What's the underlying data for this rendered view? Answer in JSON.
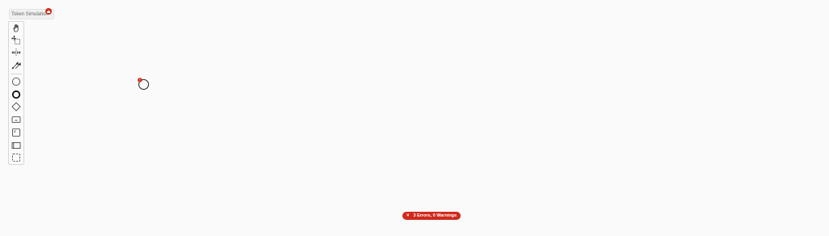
{
  "token_simulation": {
    "label": "Token Simulation"
  },
  "palette": {
    "tools": [
      {
        "icon": "hand-tool-icon"
      },
      {
        "icon": "lasso-tool-icon"
      },
      {
        "icon": "space-tool-icon"
      },
      {
        "icon": "global-connect-tool-icon"
      }
    ],
    "elements": [
      {
        "icon": "start-event-icon"
      },
      {
        "icon": "end-event-icon"
      },
      {
        "icon": "gateway-icon"
      },
      {
        "icon": "task-icon"
      },
      {
        "icon": "data-object-icon"
      },
      {
        "icon": "pool-icon"
      },
      {
        "icon": "group-icon"
      }
    ]
  },
  "lint": {
    "status_text": "3 Errors, 0 Warnings",
    "close_glyph": "×"
  },
  "colors": {
    "error": "#cf2a1c",
    "canvas": "#fafafa",
    "stroke": "#222222"
  }
}
